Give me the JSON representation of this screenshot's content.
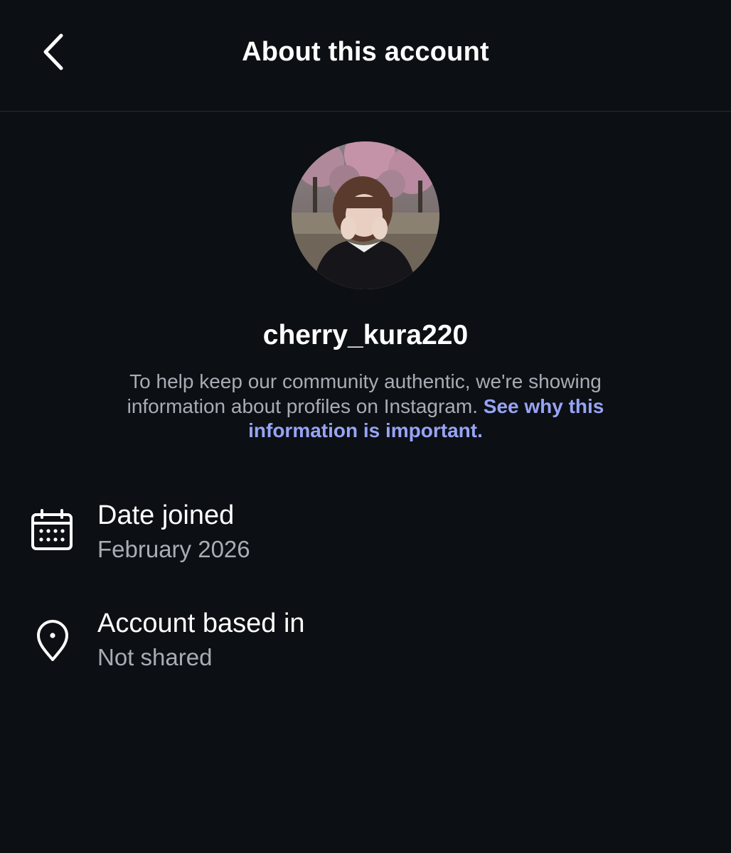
{
  "header": {
    "title": "About this account",
    "back_icon": "chevron-left-icon"
  },
  "profile": {
    "username": "cherry_kura220",
    "description_text": "To help keep our community authentic, we're showing information about profiles on Instagram. ",
    "description_link": "See why this information is important."
  },
  "details": {
    "date_joined": {
      "icon": "calendar-icon",
      "label": "Date joined",
      "value": "February 2026"
    },
    "account_based_in": {
      "icon": "location-pin-icon",
      "label": "Account based in",
      "value": "Not shared"
    }
  },
  "colors": {
    "background": "#0c0f14",
    "text_primary": "#ffffff",
    "text_secondary": "#a8adb5",
    "link": "#97a4f5",
    "divider": "#262a31"
  }
}
